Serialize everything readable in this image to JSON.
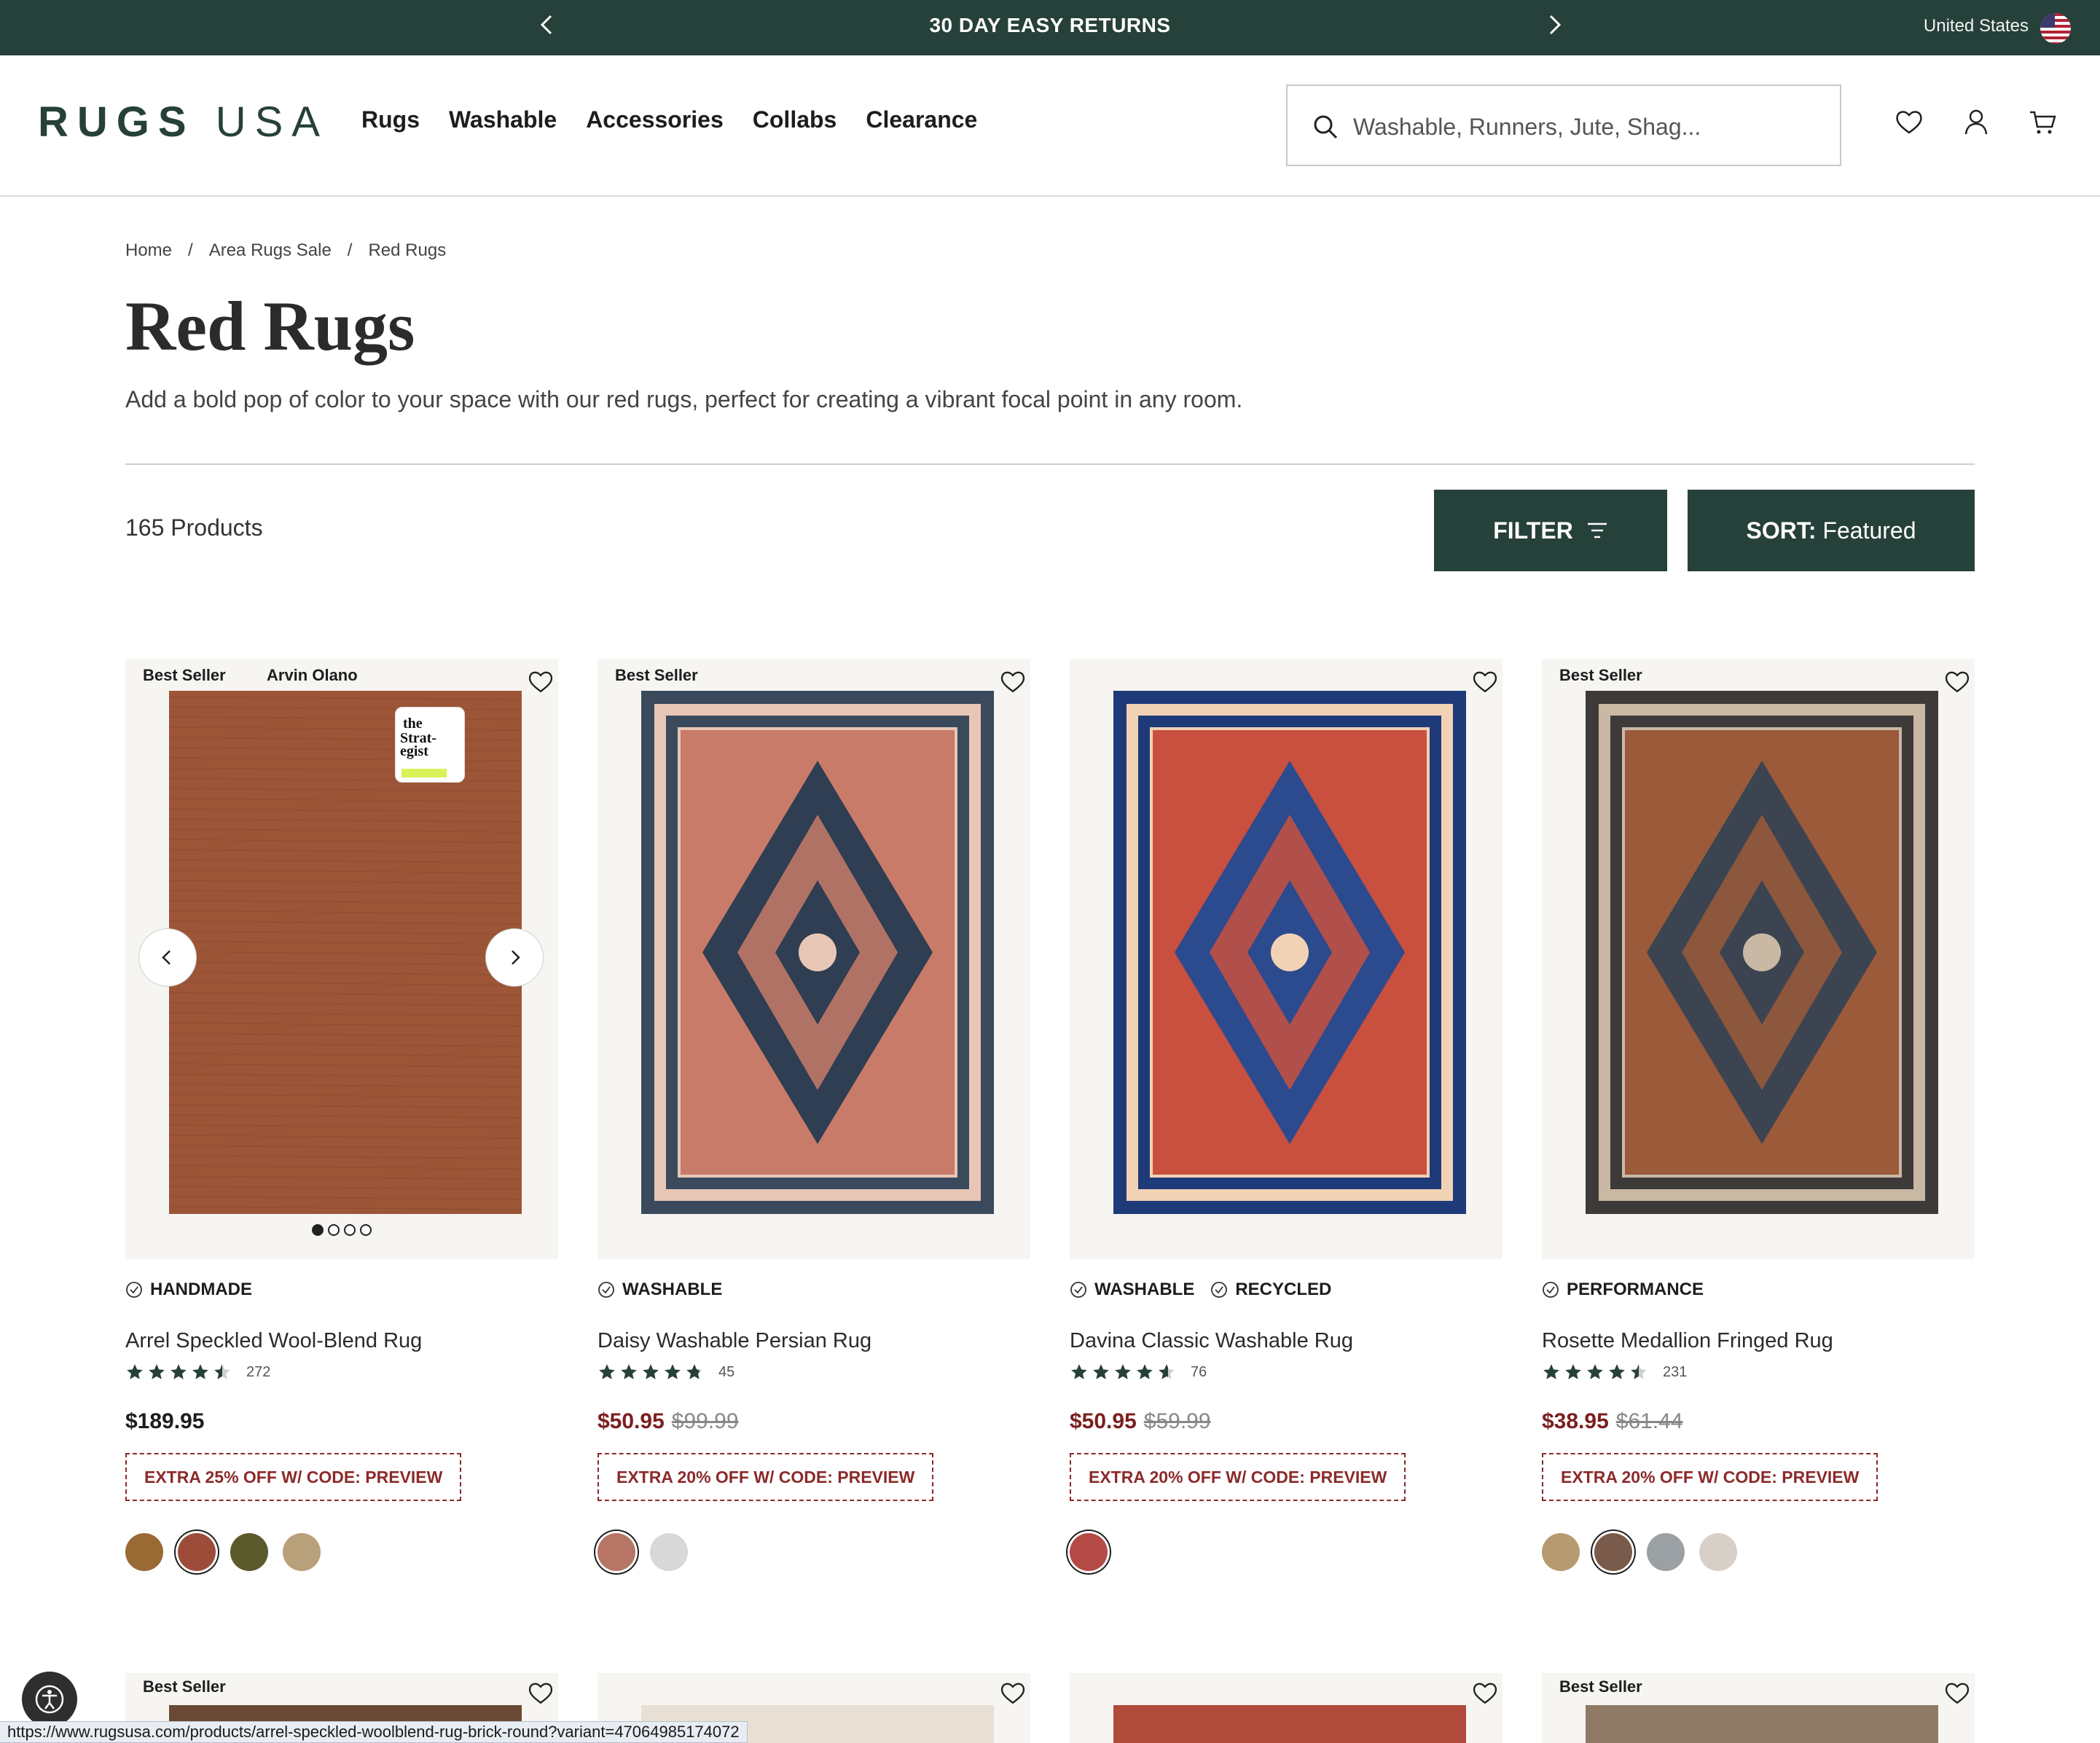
{
  "announcement": {
    "message": "30 DAY EASY RETURNS",
    "country": "United States"
  },
  "header": {
    "logo_bold": "RUGS",
    "logo_light": "USA",
    "nav": [
      "Rugs",
      "Washable",
      "Accessories",
      "Collabs",
      "Clearance"
    ],
    "search_placeholder": "Washable, Runners, Jute, Shag..."
  },
  "breadcrumb": [
    "Home",
    "/",
    "Area Rugs Sale",
    "/",
    "Red Rugs"
  ],
  "page": {
    "title": "Red Rugs",
    "description": "Add a bold pop of color to your space with our red rugs, perfect for creating a vibrant focal point in any room.",
    "count": "165 Products"
  },
  "toolbar": {
    "filter": "FILTER",
    "sort_label": "SORT:",
    "sort_value": "Featured"
  },
  "products": [
    {
      "badges": [
        "Best Seller",
        "Arvin Olano"
      ],
      "tags": [
        "HANDMADE"
      ],
      "name": "Arrel Speckled Wool-Blend Rug",
      "rating": 4.5,
      "reviews": "272",
      "price": "$189.95",
      "original_price": "",
      "promo": "EXTRA 25% OFF W/ CODE: PREVIEW",
      "swatches": [
        "#9a6a35",
        "#9c4c38",
        "#5b5a2c",
        "#b8a07a"
      ],
      "selected": 1
    },
    {
      "badges": [
        "Best Seller"
      ],
      "tags": [
        "WASHABLE"
      ],
      "name": "Daisy Washable Persian Rug",
      "rating": 4.8,
      "reviews": "45",
      "price": "$50.95",
      "original_price": "$99.99",
      "promo": "EXTRA 20% OFF W/ CODE: PREVIEW",
      "swatches": [
        "#b77566",
        "#d8d8d8"
      ],
      "selected": 0
    },
    {
      "badges": [],
      "tags": [
        "WASHABLE",
        "RECYCLED"
      ],
      "name": "Davina Classic Washable Rug",
      "rating": 4.6,
      "reviews": "76",
      "price": "$50.95",
      "original_price": "$59.99",
      "promo": "EXTRA 20% OFF W/ CODE: PREVIEW",
      "swatches": [
        "#b44a45"
      ],
      "selected": 0
    },
    {
      "badges": [
        "Best Seller"
      ],
      "tags": [
        "PERFORMANCE"
      ],
      "name": "Rosette Medallion Fringed Rug",
      "rating": 4.5,
      "reviews": "231",
      "price": "$38.95",
      "original_price": "$61.44",
      "promo": "EXTRA 20% OFF W/ CODE: PREVIEW",
      "swatches": [
        "#b79a70",
        "#7a5a4a",
        "#9aa0a4",
        "#d6d0c8"
      ],
      "selected": 1
    }
  ],
  "row2_badges": [
    "Best Seller",
    "",
    "",
    "Best Seller"
  ],
  "status_url": "https://www.rugsusa.com/products/arrel-speckled-woolblend-rug-brick-round?variant=47064985174072",
  "colors": {
    "brand": "#26403a",
    "sale": "#7a1f1f",
    "promo": "#8b2a2a"
  }
}
